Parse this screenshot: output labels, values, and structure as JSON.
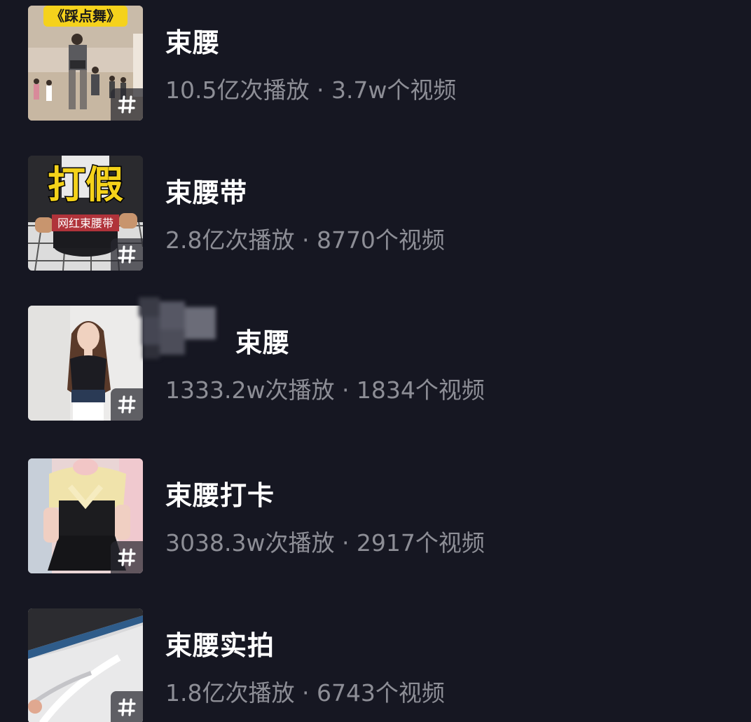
{
  "topics": [
    {
      "title": "束腰",
      "stats": "10.5亿次播放 · 3.7w个视频",
      "thumb_text": "《踩点舞》",
      "thumb_icon": "dance-studio-image",
      "badge": "#"
    },
    {
      "title": "束腰带",
      "stats": "2.8亿次播放 · 8770个视频",
      "thumb_text": "打假",
      "thumb_subtext": "网红束腰带",
      "thumb_icon": "waist-belt-image",
      "badge": "#"
    },
    {
      "title": "束腰",
      "stats": "1333.2w次播放 · 1834个视频",
      "thumb_icon": "woman-portrait-image",
      "badge": "#",
      "note": "title partially obscured by mosaic"
    },
    {
      "title": "束腰打卡",
      "stats": "3038.3w次播放 · 2917个视频",
      "thumb_icon": "outfit-image",
      "badge": "#"
    },
    {
      "title": "束腰实拍",
      "stats": "1.8亿次播放 · 6743个视频",
      "thumb_icon": "fabric-image",
      "badge": "#"
    }
  ],
  "colors": {
    "background": "#161722",
    "title": "#ffffff",
    "stats": "#8d8e96",
    "badge_bg": "rgba(40,40,48,0.72)"
  }
}
